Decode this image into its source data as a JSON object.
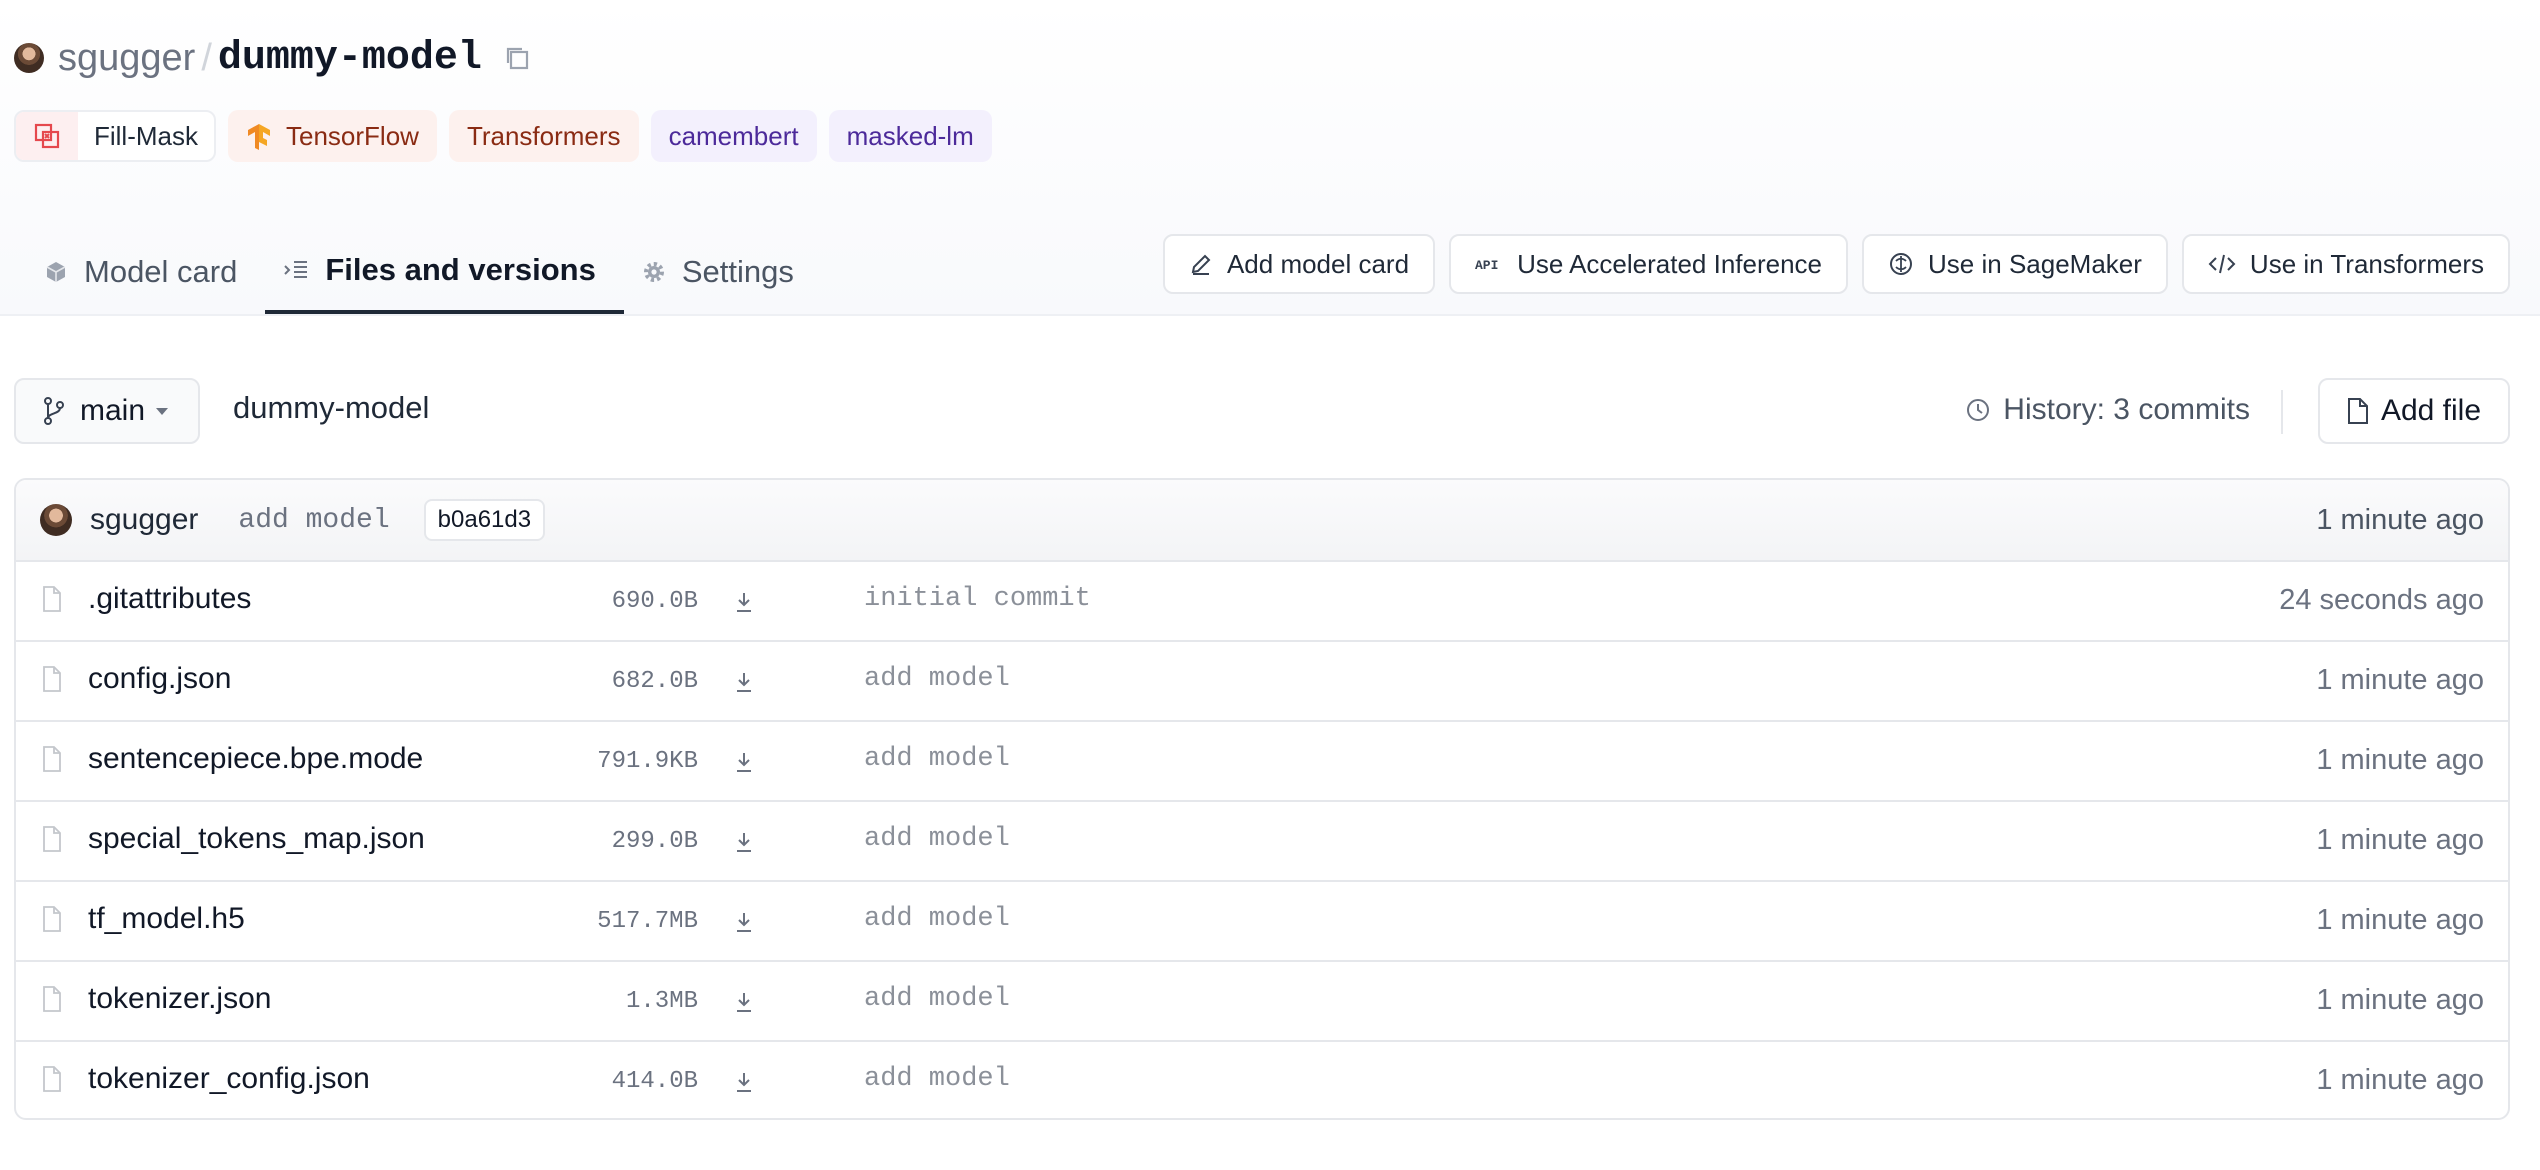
{
  "repo": {
    "owner": "sgugger",
    "separator": "/",
    "name": "dummy-model"
  },
  "tags": [
    {
      "label": "Fill-Mask",
      "icon": "fill-mask-icon"
    },
    {
      "label": "TensorFlow",
      "icon": "tensorflow-icon"
    },
    {
      "label": "Transformers"
    },
    {
      "label": "camembert"
    },
    {
      "label": "masked-lm"
    }
  ],
  "tabs": [
    {
      "label": "Model card",
      "icon": "cube-icon"
    },
    {
      "label": "Files and versions",
      "icon": "files-icon",
      "active": true
    },
    {
      "label": "Settings",
      "icon": "gear-icon"
    }
  ],
  "actions": [
    {
      "label": "Add model card",
      "icon": "pencil-icon"
    },
    {
      "label": "Use Accelerated Inference",
      "icon": "api-icon"
    },
    {
      "label": "Use in SageMaker",
      "icon": "sagemaker-icon"
    },
    {
      "label": "Use in Transformers",
      "icon": "code-icon"
    }
  ],
  "branch": {
    "name": "main"
  },
  "breadcrumb": "dummy-model",
  "history": {
    "label": "History: 3 commits"
  },
  "add_file": {
    "label": "Add file"
  },
  "last_commit": {
    "author": "sgugger",
    "message": "add model",
    "hash": "b0a61d3",
    "time": "1 minute ago"
  },
  "files": [
    {
      "name": ".gitattributes",
      "size": "690.0B",
      "message": "initial commit",
      "time": "24 seconds ago"
    },
    {
      "name": "config.json",
      "size": "682.0B",
      "message": "add model",
      "time": "1 minute ago"
    },
    {
      "name": "sentencepiece.bpe.mode",
      "size": "791.9KB",
      "message": "add model",
      "time": "1 minute ago"
    },
    {
      "name": "special_tokens_map.json",
      "size": "299.0B",
      "message": "add model",
      "time": "1 minute ago"
    },
    {
      "name": "tf_model.h5",
      "size": "517.7MB",
      "message": "add model",
      "time": "1 minute ago"
    },
    {
      "name": "tokenizer.json",
      "size": "1.3MB",
      "message": "add model",
      "time": "1 minute ago"
    },
    {
      "name": "tokenizer_config.json",
      "size": "414.0B",
      "message": "add model",
      "time": "1 minute ago"
    }
  ],
  "colors": {
    "fill_mask_accent": "#e5484d",
    "tensorflow_orange": "#f08a24",
    "framework_tag_bg": "#fdf1ee",
    "keyword_tag_bg": "#f3f0fd",
    "active_tab_underline": "#1f2937"
  }
}
